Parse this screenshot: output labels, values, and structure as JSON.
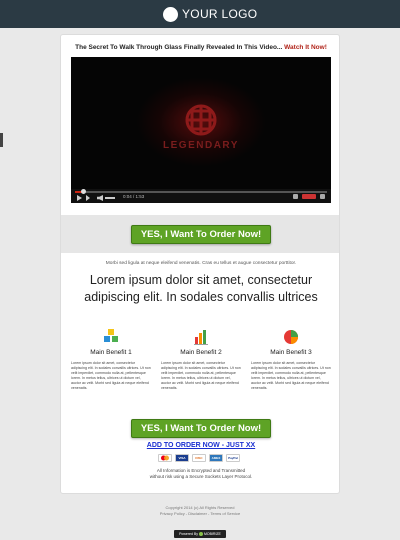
{
  "header": {
    "logo_text": "YOUR LOGO",
    "background": "#2b3a44"
  },
  "headline": {
    "prefix": "The Secret To Walk Through Glass Finally Revealed In This Video... ",
    "highlight": "Watch It Now!"
  },
  "video": {
    "title": "LEGENDARY",
    "time": "0:04 / 1:53",
    "progress_fraction": 0.03,
    "icons": [
      "play-icon",
      "next-icon",
      "volume-icon",
      "settings-icon",
      "youtube-icon",
      "fullscreen-icon"
    ]
  },
  "cta": {
    "top_label": "YES, I Want To Order Now!",
    "bottom_label": "YES, I Want To Order Now!",
    "link_label": "ADD TO ORDER NOW - JUST XX",
    "color": "#5ea325"
  },
  "subtext": "Morbi sed ligula at neque eleifend venenatis. Cras eu tellus et augue consectetur porttitor.",
  "main_heading": "Lorem ipsum dolor sit amet, consectetur adipiscing elit. In sodales convallis ultrices",
  "benefits": [
    {
      "title": "Main Benefit 1",
      "icon": "cubes-icon",
      "text": "Lorem ipsum dolor sit amet, consectetur adipiscing elit. In sodales convallis ultrices. Ut non velit imperdiet, commodo nulla at, pellentesque lorem. In metus tellus, ultrices ut dictum vel, auctor ac velit. Morbi sed ligula at neque eleifend venenatis."
    },
    {
      "title": "Main Benefit 2",
      "icon": "bar-chart-icon",
      "text": "Lorem ipsum dolor sit amet, consectetur adipiscing elit. In sodales convallis ultrices. Ut non velit imperdiet, commodo nulla at, pellentesque lorem. In metus tellus, ultrices ut dictum vel, auctor ac velit. Morbi sed ligula at neque eleifend venenatis."
    },
    {
      "title": "Main Benefit 3",
      "icon": "pie-chart-icon",
      "text": "Lorem ipsum dolor sit amet, consectetur adipiscing elit. In sodales convallis ultrices. Ut non velit imperdiet, commodo nulla at, pellentesque lorem. In metus tellus, ultrices ut dictum vel, auctor ac velit. Morbi sed ligula at neque eleifend venenatis."
    }
  ],
  "payments": [
    {
      "label": "MC",
      "color": "#f79e1b"
    },
    {
      "label": "VISA",
      "color": "#1a3d8f"
    },
    {
      "label": "DISC",
      "color": "#e06d1f"
    },
    {
      "label": "AMEX",
      "color": "#2e77bb"
    },
    {
      "label": "PayPal",
      "color": "#ffffff"
    }
  ],
  "secure_text": {
    "line1": "All Information is Encrypted and Transmitted",
    "line2": "without risk using a Secure Sockets Layer Protocol."
  },
  "footer": {
    "copyright": "Copyright 2014 (c) All Rights Reserved",
    "links": "Privacy Policy - Disclaimer - Terms of Service",
    "powered_prefix": "Powered By",
    "powered_brand": "MOBIRIZE"
  }
}
